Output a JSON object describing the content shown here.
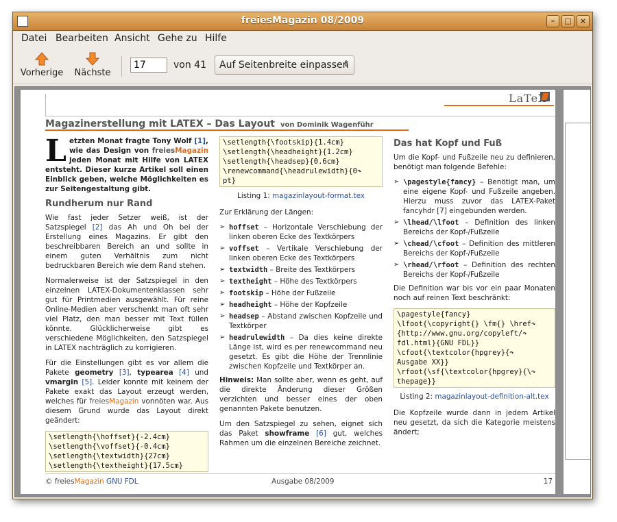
{
  "window": {
    "title": "freiesMagazin 08/2009"
  },
  "menu": [
    "Datei",
    "Bearbeiten",
    "Ansicht",
    "Gehe zu",
    "Hilfe"
  ],
  "toolbar": {
    "prev_label": "Vorherige",
    "next_label": "Nächste",
    "page_value": "17",
    "page_total": "von 41",
    "zoom_value": "Auf Seitenbreite einpassen"
  },
  "page": {
    "header_logo": "LaTeX",
    "title": "Magazinerstellung mit LATEX – Das Layout",
    "author": "von Dominik Wagenführ",
    "col1": {
      "dropcap": "L",
      "lead_a": "etzten Monat fragte Tony Wolf ",
      "lead_ref": "[1]",
      "lead_b": ", wie das Design von ",
      "lead_brand_a": "freies",
      "lead_brand_b": "Magazin",
      "lead_c": " jeden Monat mit Hilfe von LATEX entsteht. Dieser kurze Artikel soll einen Einblick geben, welche Möglichkeiten es zur Seitengestaltung gibt.",
      "h1": "Rundherum nur Rand",
      "p1a": "Wie fast jeder Setzer weiß, ist der Satzspiegel ",
      "p1ref": "[2]",
      "p1b": " das Ah und Oh bei der Erstellung eines Magazins. Er gibt den beschreibbaren Bereich an und sollte in einem guten Verhältnis zum nicht bedruckbaren Bereich wie dem Rand stehen.",
      "p2": "Normalerweise ist der Satzspiegel in den einzelnen LATEX-Dokumentenklassen sehr gut für Printmedien ausgewählt. Für reine Online-Medien aber verschenkt man oft sehr viel Platz, den man besser mit Text füllen könnte. Glücklicherweise gibt es verschiedene Möglichkeiten, den Satzspiegel in LATEX nachträglich zu korrigieren.",
      "p3a": "Für die Einstellungen gibt es vor allem die Pakete ",
      "p3b1": "geometry",
      "p3r1": " [3]",
      "p3c": ", ",
      "p3b2": "typearea",
      "p3r2": " [4]",
      "p3d": " und ",
      "p3b3": "vmargin",
      "p3r3": " [5]",
      "p3e": ". Leider konnte mit keinem der Pakete exakt das Layout erzeugt werden, welches für ",
      "p3brand_a": "freies",
      "p3brand_b": "Magazin",
      "p3f": " vonnöten war. Aus diesem Grund wurde das Layout direkt geändert:",
      "code": "\\setlength{\\hoffset}{-2.4cm}\n\\setlength{\\voffset}{-0.4cm}\n\\setlength{\\textwidth}{27cm}\n\\setlength{\\textheight}{17.5cm}"
    },
    "col2": {
      "code": "\\setlength{\\footskip}{1.4cm}\n\\setlength{\\headheight}{1.2cm}\n\\setlength{\\headsep}{0.6cm}\n\\renewcommand{\\headrulewidth}{0↷\npt}",
      "caption_a": "Listing 1: ",
      "caption_b": "magazinlayout-format.tex",
      "intro": "Zur Erklärung der Längen:",
      "items": [
        {
          "k": "hoffset",
          "t": " – Horizontale Verschiebung der linken oberen Ecke des Textkörpers"
        },
        {
          "k": "voffset",
          "t": " – Vertikale Verschiebung der linken oberen Ecke des Textkörpers"
        },
        {
          "k": "textwidth",
          "t": " – Breite des Textkörpers"
        },
        {
          "k": "textheight",
          "t": " – Höhe des Textkörpers"
        },
        {
          "k": "footskip",
          "t": " – Höhe der Fußzeile"
        },
        {
          "k": "headheight",
          "t": " – Höhe der Kopfzeile"
        },
        {
          "k": "headsep",
          "t": " – Abstand zwischen Kopfzeile und Textkörper"
        },
        {
          "k": "headrulewidth",
          "t": " – Da dies keine direkte Länge ist, wird es per renewcommand neu gesetzt. Es gibt die Höhe der Trennlinie zwischen Kopfzeile und Textkörper an."
        }
      ],
      "hint_b": "Hinweis:",
      "hint": " Man sollte aber, wenn es geht, auf die direkte Änderung dieser Größen verzichten und besser eines der oben genannten Pakete benutzen.",
      "p_a": "Um den Satzspiegel zu sehen, eignet sich das Paket ",
      "p_b": "showframe",
      "p_r": " [6]",
      "p_c": " gut, welches Rahmen um die einzelnen Bereiche zeichnet."
    },
    "col3": {
      "h1": "Das hat Kopf und Fuß",
      "p1": "Um die Kopf- und Fußzeile neu zu definieren, benötigt man folgende Befehle:",
      "items": [
        {
          "k": "\\pagestyle{fancy}",
          "t": " – Benötigt man, um eine eigene Kopf- und Fußzeile angeben. Hierzu muss zuvor das LATEX-Paket fancyhdr [7] eingebunden werden."
        },
        {
          "k": "\\lhead/\\lfoot",
          "t": " – Definition des linken Bereichs der Kopf-/Fußzeile"
        },
        {
          "k": "\\chead/\\cfoot",
          "t": " – Definition des mittleren Bereichs der Kopf-/Fußzeile"
        },
        {
          "k": "\\rhead/\\rfoot",
          "t": " – Definition des rechten Bereichs der Kopf-/Fußzeile"
        }
      ],
      "p2": "Die Definition war bis vor ein paar Monaten noch auf reinen Text beschränkt:",
      "code": "\\pagestyle{fancy}\n\\lfoot{\\copyright{} \\fm{} \\href↷\n{http://www.gnu.org/copyleft/↷\nfdl.html}{GNU FDL}}\n\\cfoot{\\textcolor{hpgrey}{↷\nAusgabe XX}}\n\\rfoot{\\sf{\\textcolor{hpgrey}{\\↷\nthepage}}",
      "caption_a": "Listing 2: ",
      "caption_b": "magazinlayout-definition-alt.tex",
      "p3": "Die Kopfzeile wurde dann in jedem Artikel neu gesetzt, da sich die Kategorie meistens ändert;"
    },
    "footer": {
      "copy": "© freies",
      "brand": "Magazin",
      "license": " GNU FDL",
      "issue": "Ausgabe 08/2009",
      "number": "17"
    }
  },
  "colors": {
    "titlebar": "#d2934a",
    "accent": "#e06a1a",
    "link": "#2b4fa0",
    "code_bg": "#fffde4"
  }
}
